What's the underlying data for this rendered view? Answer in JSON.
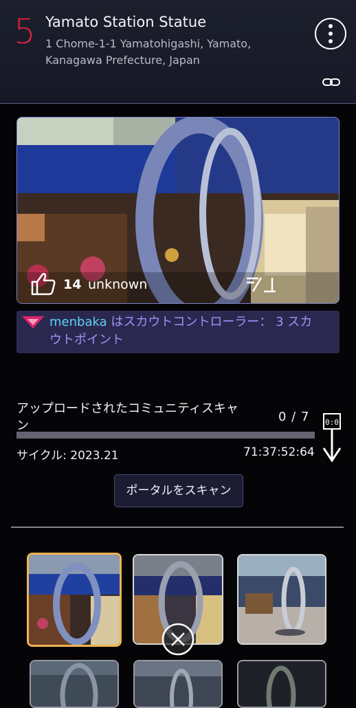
{
  "portal": {
    "level": "5",
    "title": "Yamato Station Statue",
    "address": "1 Chome-1-1 Yamatohigashi, Yamato, Kanagawa Prefecture, Japan"
  },
  "icons": {
    "menu": "more-vertical-icon",
    "link": "link-icon",
    "like": "thumbs-up-icon",
    "report": "report-icon",
    "badge": "scout-badge-icon",
    "download": "download-arrow-icon",
    "close": "close-circle-icon"
  },
  "photo": {
    "like_count": "14",
    "uploader": "unknown"
  },
  "scout": {
    "user": "menbaka",
    "message": " はスカウトコントローラー： 3 スカウトポイント"
  },
  "community": {
    "label": "アップロードされたコミュニティスキャン",
    "count": "0 / 7",
    "progress": 0.0,
    "cycle": "サイクル: 2023.21",
    "timer": "71:37:52:64",
    "download_label": "0:0"
  },
  "actions": {
    "scan_button": "ポータルをスキャン"
  },
  "colors": {
    "level": "#d3243f",
    "scout_user": "#5bd3f2",
    "scout_text": "#a48ff6",
    "selected_thumb": "#f0b450"
  }
}
